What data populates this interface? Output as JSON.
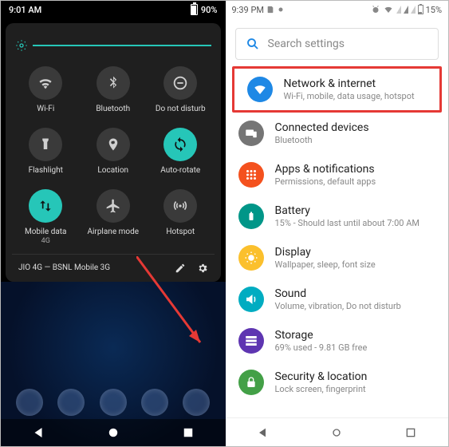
{
  "left": {
    "status": {
      "time": "9:01 AM",
      "battery": "90%"
    },
    "tiles": [
      {
        "label": "Wi-Fi",
        "icon": "wifi-icon",
        "active": false
      },
      {
        "label": "Bluetooth",
        "icon": "bluetooth-icon",
        "active": false
      },
      {
        "label": "Do not disturb",
        "icon": "dnd-icon",
        "active": false
      },
      {
        "label": "Flashlight",
        "icon": "flashlight-icon",
        "active": false
      },
      {
        "label": "Location",
        "icon": "location-icon",
        "active": false
      },
      {
        "label": "Auto-rotate",
        "icon": "rotate-icon",
        "active": true
      },
      {
        "label": "Mobile data",
        "sub": "4G",
        "icon": "mobiledata-icon",
        "active": true
      },
      {
        "label": "Airplane mode",
        "icon": "airplane-icon",
        "active": false
      },
      {
        "label": "Hotspot",
        "icon": "hotspot-icon",
        "active": false
      }
    ],
    "footer": {
      "carrier": "JIO 4G — BSNL Mobile 3G"
    }
  },
  "right": {
    "status": {
      "time": "9:39 PM",
      "battery": "15%"
    },
    "search_placeholder": "Search settings",
    "items": [
      {
        "title": "Network & internet",
        "subtitle": "Wi-Fi, mobile, data usage, hotspot",
        "color": "#1e88e5",
        "icon": "wifi-icon",
        "highlight": true
      },
      {
        "title": "Connected devices",
        "subtitle": "Bluetooth",
        "color": "#757575",
        "icon": "devices-icon"
      },
      {
        "title": "Apps & notifications",
        "subtitle": "Permissions, default apps",
        "color": "#f4511e",
        "icon": "apps-icon"
      },
      {
        "title": "Battery",
        "subtitle": "15% - Should last until about 7:00 AM",
        "color": "#009688",
        "icon": "battery-icon"
      },
      {
        "title": "Display",
        "subtitle": "Wallpaper, sleep, font size",
        "color": "#fbc02d",
        "icon": "display-icon"
      },
      {
        "title": "Sound",
        "subtitle": "Volume, vibration, Do not disturb",
        "color": "#00acc1",
        "icon": "sound-icon"
      },
      {
        "title": "Storage",
        "subtitle": "69% used - 9.81 GB free",
        "color": "#5e35b1",
        "icon": "storage-icon"
      },
      {
        "title": "Security & location",
        "subtitle": "Lock screen, fingerprint",
        "color": "#43a047",
        "icon": "security-icon"
      }
    ]
  }
}
